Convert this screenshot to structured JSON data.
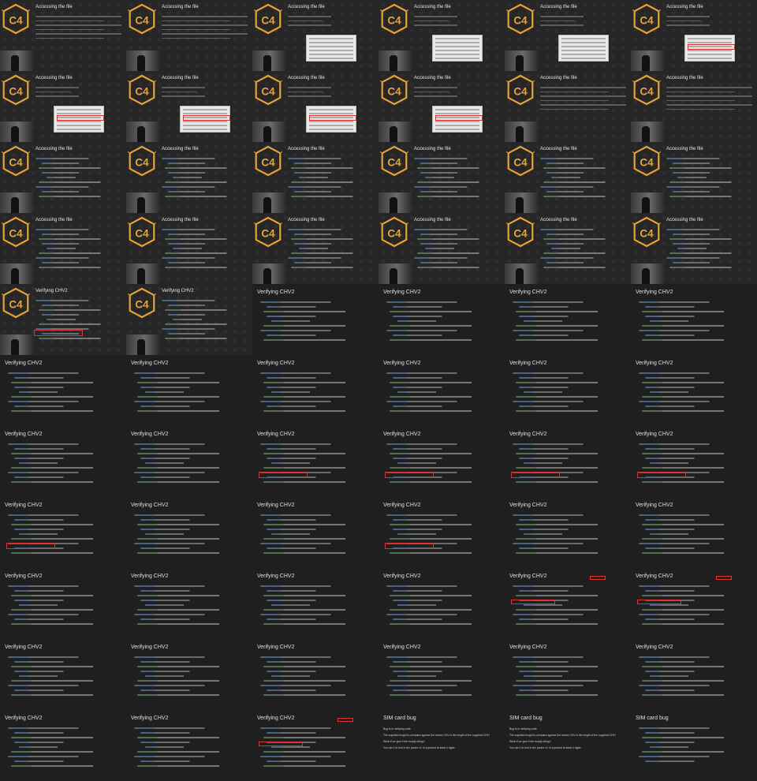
{
  "colors": {
    "background": "#1e1e1e",
    "slide": "#262626",
    "logo_orange": "#e8a33a",
    "highlight_red": "#dd3333",
    "code_blue": "#5b7fae"
  },
  "titles": {
    "accessing": "Accessing the file",
    "verifying": "Verifying CHV2",
    "sim_bug": "SIM card bug"
  },
  "logo_text": "C4",
  "sim_card_bug_text": [
    "Bug is in verifying code",
    "The supplied length to compare against the stored CHV is the length of the supplied CHV!",
    "What if we give it the empty string?",
    "You can't do this in the phone UI. It expected at least 4 digits."
  ],
  "slides": [
    {
      "title": "accessing",
      "style": "intro"
    },
    {
      "title": "accessing",
      "style": "text"
    },
    {
      "title": "accessing",
      "style": "shot"
    },
    {
      "title": "accessing",
      "style": "shot"
    },
    {
      "title": "accessing",
      "style": "shot"
    },
    {
      "title": "accessing",
      "style": "shot-hl"
    },
    {
      "title": "accessing",
      "style": "shot-hl"
    },
    {
      "title": "accessing",
      "style": "shot-hl"
    },
    {
      "title": "accessing",
      "style": "shot-hl"
    },
    {
      "title": "accessing",
      "style": "shot-hl"
    },
    {
      "title": "accessing",
      "style": "text"
    },
    {
      "title": "accessing",
      "style": "text"
    },
    {
      "title": "accessing",
      "style": "code-logo"
    },
    {
      "title": "accessing",
      "style": "code-logo"
    },
    {
      "title": "accessing",
      "style": "code-logo"
    },
    {
      "title": "accessing",
      "style": "code-logo"
    },
    {
      "title": "accessing",
      "style": "code-logo"
    },
    {
      "title": "accessing",
      "style": "code-logo"
    },
    {
      "title": "accessing",
      "style": "code-logo"
    },
    {
      "title": "accessing",
      "style": "code-logo"
    },
    {
      "title": "accessing",
      "style": "code-logo"
    },
    {
      "title": "accessing",
      "style": "code-logo"
    },
    {
      "title": "accessing",
      "style": "code-logo"
    },
    {
      "title": "accessing",
      "style": "code-logo"
    },
    {
      "title": "verifying",
      "style": "code-logo-hl"
    },
    {
      "title": "verifying",
      "style": "code-logo"
    },
    {
      "title": "verifying",
      "style": "code"
    },
    {
      "title": "verifying",
      "style": "code"
    },
    {
      "title": "verifying",
      "style": "code"
    },
    {
      "title": "verifying",
      "style": "code"
    },
    {
      "title": "verifying",
      "style": "code"
    },
    {
      "title": "verifying",
      "style": "code"
    },
    {
      "title": "verifying",
      "style": "code"
    },
    {
      "title": "verifying",
      "style": "code"
    },
    {
      "title": "verifying",
      "style": "code"
    },
    {
      "title": "verifying",
      "style": "code"
    },
    {
      "title": "verifying",
      "style": "code"
    },
    {
      "title": "verifying",
      "style": "code"
    },
    {
      "title": "verifying",
      "style": "code-hl"
    },
    {
      "title": "verifying",
      "style": "code-hl"
    },
    {
      "title": "verifying",
      "style": "code-hl"
    },
    {
      "title": "verifying",
      "style": "code-hl"
    },
    {
      "title": "verifying",
      "style": "code-hl"
    },
    {
      "title": "verifying",
      "style": "code"
    },
    {
      "title": "verifying",
      "style": "code"
    },
    {
      "title": "verifying",
      "style": "code-hl"
    },
    {
      "title": "verifying",
      "style": "code"
    },
    {
      "title": "verifying",
      "style": "code"
    },
    {
      "title": "verifying",
      "style": "code"
    },
    {
      "title": "verifying",
      "style": "code"
    },
    {
      "title": "verifying",
      "style": "code"
    },
    {
      "title": "verifying",
      "style": "code"
    },
    {
      "title": "verifying",
      "style": "code-hl2"
    },
    {
      "title": "verifying",
      "style": "code-hl2"
    },
    {
      "title": "verifying",
      "style": "code"
    },
    {
      "title": "verifying",
      "style": "code"
    },
    {
      "title": "verifying",
      "style": "code"
    },
    {
      "title": "verifying",
      "style": "code"
    },
    {
      "title": "verifying",
      "style": "code"
    },
    {
      "title": "verifying",
      "style": "code"
    },
    {
      "title": "verifying",
      "style": "code"
    },
    {
      "title": "verifying",
      "style": "code"
    },
    {
      "title": "verifying",
      "style": "code-hl2"
    },
    {
      "title": "sim_bug",
      "style": "sim"
    },
    {
      "title": "sim_bug",
      "style": "sim"
    },
    {
      "title": "sim_bug",
      "style": "sim-code"
    }
  ]
}
